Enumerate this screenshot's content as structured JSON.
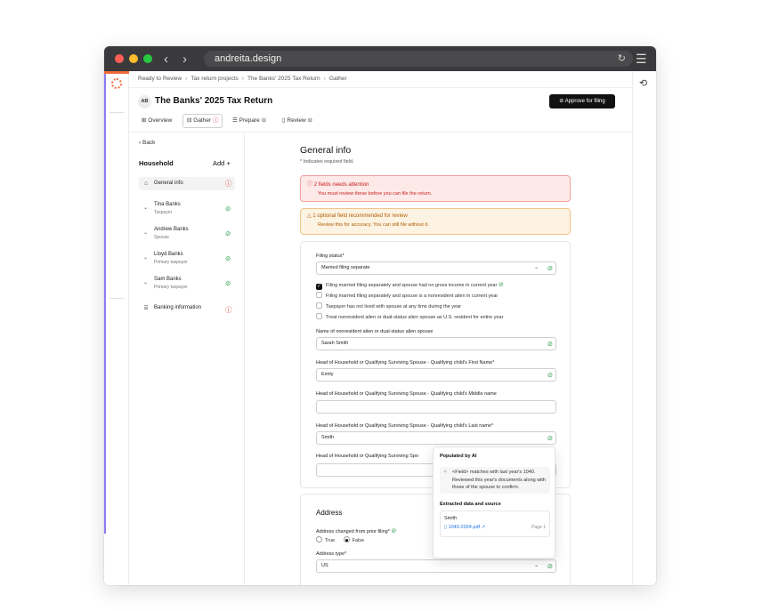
{
  "browser": {
    "url": "andreita.design",
    "colors": {
      "close": "#ff5f57",
      "minimize": "#febc2e",
      "zoom": "#28c840",
      "titlebar": "#3a3a3c"
    }
  },
  "breadcrumb": [
    "Ready to Review",
    "Tax return projects",
    "The Banks' 2025 Tax Return",
    "Gather"
  ],
  "header": {
    "avatar": "AB",
    "title": "The Banks' 2025 Tax Return",
    "approve_label": "Approve for filing"
  },
  "tabs": [
    {
      "label": "Overview",
      "icon": "grid-icon"
    },
    {
      "label": "Gather",
      "icon": "table-icon",
      "status": "alert"
    },
    {
      "label": "Prepare",
      "icon": "list-icon",
      "status": "pending"
    },
    {
      "label": "Review",
      "icon": "doc-icon",
      "status": "pending"
    }
  ],
  "sidebar": {
    "back": "Back",
    "section": "Household",
    "add": "Add",
    "items": [
      {
        "name": "General info",
        "icon": "home-icon",
        "status": "alert"
      },
      {
        "name": "Tina Banks",
        "sub": "Taxpayer",
        "status": "ok"
      },
      {
        "name": "Andrew Banks",
        "sub": "Spouse",
        "status": "ok"
      },
      {
        "name": "Lloyd Banks",
        "sub": "Primary taxpayer",
        "status": "ok"
      },
      {
        "name": "Sam Banks",
        "sub": "Primary taxpayer",
        "status": "ok"
      },
      {
        "name": "Banking information",
        "icon": "bank-icon",
        "status": "alert"
      }
    ]
  },
  "main": {
    "title": "General info",
    "required_note": "* Indicates required field.",
    "alert_red": {
      "title": "2 fields needs attention",
      "body": "You must review these before you can file the return."
    },
    "alert_yellow": {
      "title": "1 optional field recommended for review",
      "body": "Review this for accuracy. You can still file without it."
    },
    "filing_status": {
      "label": "Filing status*",
      "value": "Married filing separate"
    },
    "checkboxes": [
      {
        "label": "Filing married filing separately and spouse had no gross income in current year",
        "checked": true
      },
      {
        "label": "Filing married filing separately and spouse is a nonresident alien in current year",
        "checked": false
      },
      {
        "label": "Taxpayer has not lived with spouse at any time during the year",
        "checked": false
      },
      {
        "label": "Treat nonresident alien or dual-status alien spouse as U.S. resident for entire year",
        "checked": false
      }
    ],
    "fields": [
      {
        "label": "Name of nonresident alien or dual-status alien spouse",
        "value": "Sarah Smith"
      },
      {
        "label": "Head of Household or Qualifying Surviving Spouse - Qualifying child's First Name*",
        "value": "Emily"
      },
      {
        "label": "Head of Household or Qualifying Surviving Spouse - Qualifying child's Middle name",
        "value": ""
      },
      {
        "label": "Head of Household or Qualifying Surviving Spouse - Qualifying child's Last name*",
        "value": "Smith"
      },
      {
        "label": "Head of Household or Qualifying Surviving Spo",
        "value": ""
      }
    ],
    "address": {
      "title": "Address",
      "changed_label": "Address changed from prior filing*",
      "true_label": "True",
      "false_label": "False",
      "type_label": "Address type*",
      "type_value": "US"
    }
  },
  "popover": {
    "title": "Populated by AI",
    "text": "<Field> matches with last year's 1040. Reviewed this year's documents along with those of the spouse to confirm.",
    "sub": "Extracted data and source",
    "value": "Smith",
    "file": "1040-2024.pdf",
    "page": "Page 1"
  }
}
